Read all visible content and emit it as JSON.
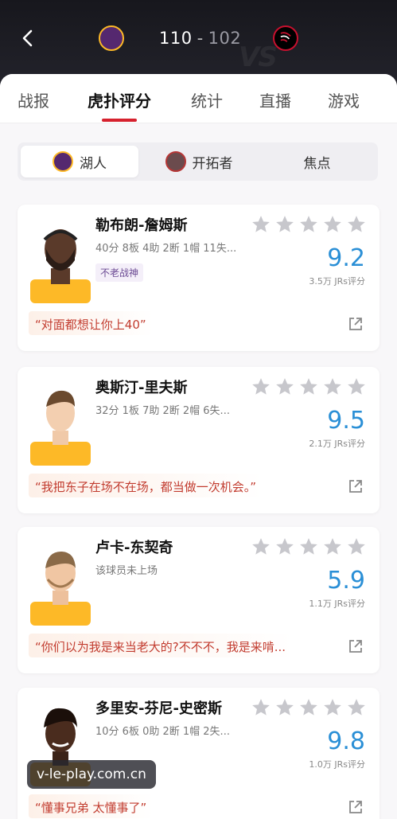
{
  "header": {
    "home_score": "110",
    "score_sep": "-",
    "away_score": "102"
  },
  "tabs": [
    {
      "label": "战报"
    },
    {
      "label": "虎扑评分",
      "active": true
    },
    {
      "label": "统计"
    },
    {
      "label": "直播"
    },
    {
      "label": "游戏"
    }
  ],
  "segments": [
    {
      "label": "湖人",
      "active": true
    },
    {
      "label": "开拓者"
    },
    {
      "label": "焦点"
    }
  ],
  "players": [
    {
      "name": "勒布朗-詹姆斯",
      "stats": "40分 8板 4助 2断 1帽 11失...",
      "tag": "不老战神",
      "rating": "9.2",
      "votes": "3.5万 JRs评分",
      "quote": "“对面都想让你上40”"
    },
    {
      "name": "奥斯汀-里夫斯",
      "stats": "32分 1板 7助 2断 2帽 6失...",
      "rating": "9.5",
      "votes": "2.1万 JRs评分",
      "quote": "“我把东子在场不在场，都当做一次机会。”"
    },
    {
      "name": "卢卡-东契奇",
      "stats": "该球员未上场",
      "rating": "5.9",
      "votes": "1.1万 JRs评分",
      "quote": "“你们以为我是来当老大的?不不不，我是来啃..."
    },
    {
      "name": "多里安-芬尼-史密斯",
      "stats": "10分 6板 0助 2断 1帽 2失...",
      "rating": "9.8",
      "votes": "1.0万 JRs评分",
      "quote": "“懂事兄弟 太懂事了”"
    }
  ],
  "watermark": "v-le-play.com.cn",
  "colors": {
    "accent_red": "#d6212e",
    "rating_blue": "#2a8fd6",
    "quote_red": "#c23c2f",
    "lakers_purple": "#55286f",
    "lakers_gold": "#fdb927"
  }
}
